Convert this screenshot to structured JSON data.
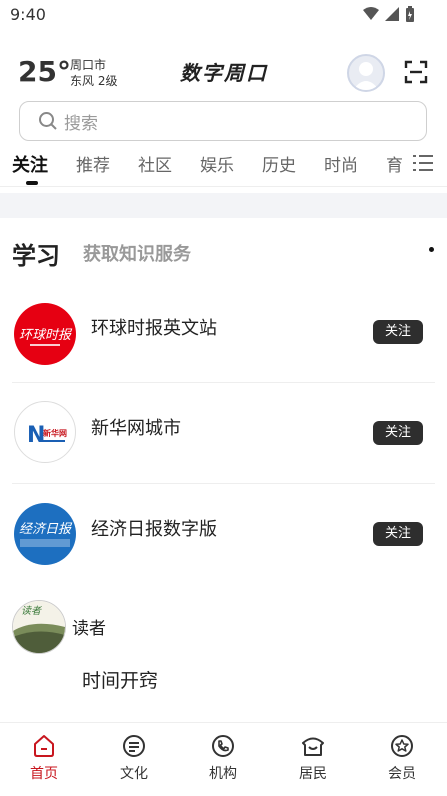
{
  "status_bar": {
    "time": "9:40"
  },
  "header": {
    "temperature": "25°",
    "city": "周口市",
    "wind": "东风 2级",
    "brand": "数字周口"
  },
  "search": {
    "placeholder": "搜索"
  },
  "tabs": [
    {
      "label": "关注",
      "active": true
    },
    {
      "label": "推荐"
    },
    {
      "label": "社区"
    },
    {
      "label": "娱乐"
    },
    {
      "label": "历史"
    },
    {
      "label": "时尚"
    },
    {
      "label": "育"
    }
  ],
  "study_card": {
    "title": "学习",
    "subtitle": "获取知识服务",
    "items": [
      {
        "name": "环球时报英文站",
        "follow_label": "关注",
        "logo_icon": "global-times-logo",
        "logo_text": "环球时报"
      },
      {
        "name": "新华网城市",
        "follow_label": "关注",
        "logo_icon": "xinhuanet-logo",
        "logo_text": "新华网"
      },
      {
        "name": "经济日报数字版",
        "follow_label": "关注",
        "logo_icon": "economic-daily-logo",
        "logo_text": "经济日报"
      }
    ]
  },
  "reader_card": {
    "author": "读者",
    "avatar_text": "读者",
    "title": "时间开窍"
  },
  "bottom_nav": [
    {
      "label": "首页",
      "icon": "home-icon",
      "active": true
    },
    {
      "label": "文化",
      "icon": "culture-icon"
    },
    {
      "label": "机构",
      "icon": "phone-icon"
    },
    {
      "label": "居民",
      "icon": "residents-icon"
    },
    {
      "label": "会员",
      "icon": "member-icon"
    }
  ],
  "colors": {
    "accent": "#c8161e",
    "follow_button": "#2e2e2e"
  }
}
